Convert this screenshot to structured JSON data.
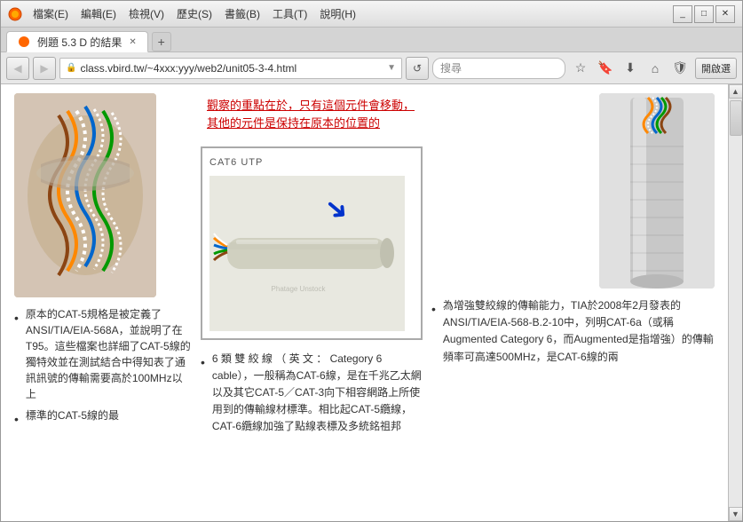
{
  "browser": {
    "title": "例題 5.3 D 的結果",
    "menu_items": [
      "檔案(E)",
      "編輯(E)",
      "檢視(V)",
      "歷史(S)",
      "書籤(B)",
      "工具(T)",
      "說明(H)"
    ],
    "tab_label": "例題 5.3 D 的結果",
    "url": "class.vbird.tw/~4xxx:yyy/web2/unit05-3-4.html",
    "search_placeholder": "搜尋",
    "open_button": "開啟選",
    "window_controls": [
      "_",
      "□",
      "✕"
    ]
  },
  "page": {
    "annotation_line1": "觀察的重點在於，只有這個元件會移動，",
    "annotation_line2": "其他的元件是保持在原本的位置的",
    "cat6_label": "CAT6 UTP",
    "left_bullet1": "原本的CAT-5規格是被定義了ANSI/TIA/EIA-568A，並說明了在T95。這些檔案也詳細了CAT-5線的獨特效並在測試結合中得知表了通訊訊號的傳輸需要高於100MHz以上",
    "left_bullet2": "標準的CAT-5線的最",
    "center_bullet": "6 類 雙 絞 線 （ 英 文 ： Category 6 cable），一般稱為CAT-6線，是在千兆乙太網以及其它CAT-5／CAT-3向下相容網路上所使用到的傳輸線材標準。相比起CAT-5纜線，CAT-6纜線加強了點線表標及多統銘祖邦",
    "right_bullet": "為增強雙絞線的傳輸能力，TIA於2008年2月發表的ANSI/TIA/EIA-568-B.2-10中，列明CAT-6a（或稱Augmented Category 6，而Augmented是指增強）的傳輸頻率可高達500MHz，是CAT-6線的兩",
    "augmented_text": "Augmented"
  }
}
